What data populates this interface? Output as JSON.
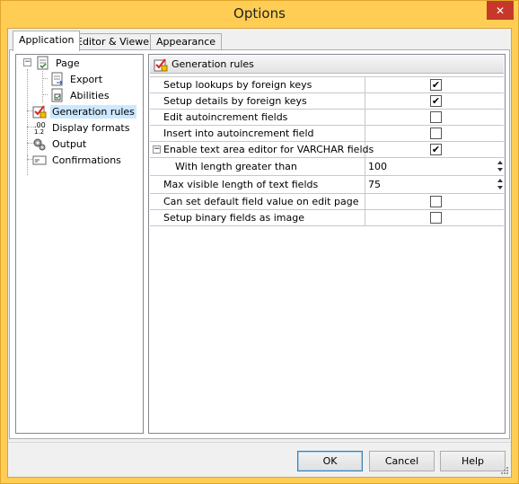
{
  "window": {
    "title": "Options",
    "close_glyph": "✕"
  },
  "tabs": [
    {
      "label": "Application",
      "active": true
    },
    {
      "label": "Editor & Viewers",
      "active": false
    },
    {
      "label": "Appearance",
      "active": false
    }
  ],
  "tree": {
    "items": [
      {
        "label": "Page",
        "icon": "page-icon",
        "expanded": true
      },
      {
        "label": "Export",
        "icon": "export-icon"
      },
      {
        "label": "Abilities",
        "icon": "abilities-icon"
      },
      {
        "label": "Generation rules",
        "icon": "generation-rules-icon",
        "selected": true
      },
      {
        "label": "Display formats",
        "icon": "display-formats-icon"
      },
      {
        "label": "Output",
        "icon": "output-icon"
      },
      {
        "label": "Confirmations",
        "icon": "confirmations-icon"
      }
    ],
    "expander_glyph": "−"
  },
  "panel": {
    "header": "Generation rules",
    "rows": [
      {
        "name": "Setup lookups by foreign keys",
        "type": "checkbox",
        "checked": true
      },
      {
        "name": "Setup details by foreign keys",
        "type": "checkbox",
        "checked": true
      },
      {
        "name": "Edit autoincrement fields",
        "type": "checkbox",
        "checked": false
      },
      {
        "name": "Insert into autoincrement field",
        "type": "checkbox",
        "checked": false
      },
      {
        "name": "Enable text area editor for VARCHAR fields",
        "type": "checkbox",
        "checked": true,
        "expandable": true
      },
      {
        "name": "With length greater than",
        "type": "number",
        "value": "100",
        "child": true
      },
      {
        "name": "Max visible length of text fields",
        "type": "number",
        "value": "75"
      },
      {
        "name": "Can set default field value on edit page",
        "type": "checkbox",
        "checked": false
      },
      {
        "name": "Setup binary fields as image",
        "type": "checkbox",
        "checked": false
      }
    ],
    "check_glyph": "✔"
  },
  "buttons": {
    "ok": "OK",
    "cancel": "Cancel",
    "help": "Help"
  },
  "colors": {
    "frame": "#ffcd54",
    "close": "#c7382b",
    "selection": "#cce8ff",
    "default_button_border": "#3c7fb1"
  }
}
